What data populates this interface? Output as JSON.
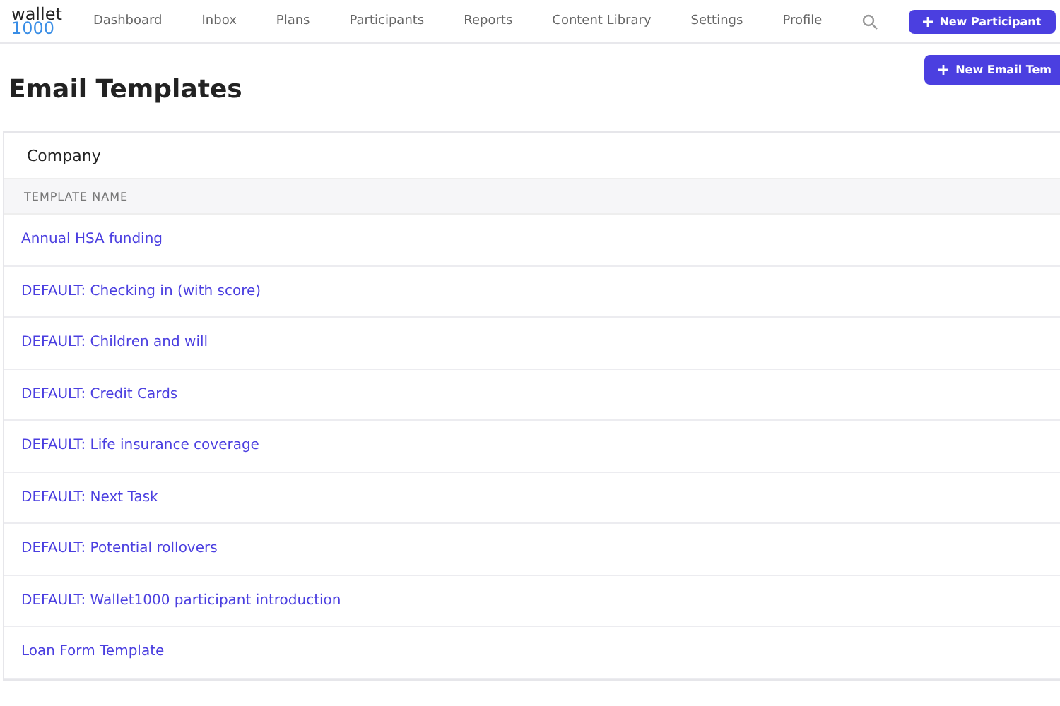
{
  "logo": {
    "line_1": "wallet",
    "line_2": "1000"
  },
  "nav": {
    "items": [
      {
        "label": "Dashboard",
        "selected": false
      },
      {
        "label": "Inbox",
        "selected": false
      },
      {
        "label": "Plans",
        "selected": false
      },
      {
        "label": "Participants",
        "selected": false
      },
      {
        "label": "Reports",
        "selected": false
      },
      {
        "label": "Content Library",
        "selected": false
      },
      {
        "label": "Settings",
        "selected": false
      },
      {
        "label": "Profile",
        "selected": false
      }
    ],
    "new_participant_button": "New Participant"
  },
  "page": {
    "title": "Email Templates",
    "new_button": "New Email Tem"
  },
  "card": {
    "title": "Company",
    "table": {
      "columns": [
        "TEMPLATE NAME"
      ],
      "rows": [
        {
          "name": "Annual HSA funding"
        },
        {
          "name": "DEFAULT: Checking in (with score)"
        },
        {
          "name": "DEFAULT: Children and will"
        },
        {
          "name": "DEFAULT: Credit Cards"
        },
        {
          "name": "DEFAULT: Life insurance coverage"
        },
        {
          "name": "DEFAULT: Next Task"
        },
        {
          "name": "DEFAULT: Potential rollovers"
        },
        {
          "name": "DEFAULT: Wallet1000 participant introduction"
        },
        {
          "name": "Loan Form Template"
        }
      ]
    }
  }
}
